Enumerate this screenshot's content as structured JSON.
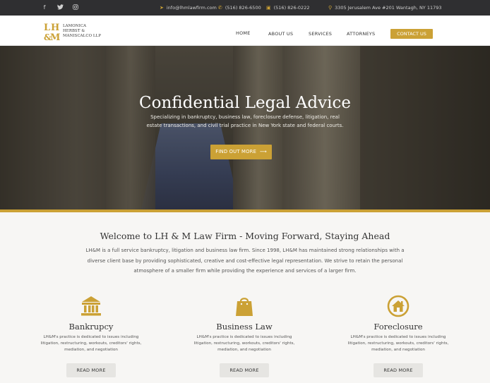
{
  "topbar": {
    "social": [
      "facebook-icon",
      "twitter-icon",
      "instagram-icon"
    ],
    "email": "info@lhmlawfirm.com",
    "phone": "(516) 826-6500",
    "fax": "(516) 826-0222",
    "address": "3305 Jerusalem Ave #201 Wantagh, NY 11793"
  },
  "logo": {
    "line1": "LAMONICA",
    "line2": "HERBST &",
    "line3": "MANISCALCO LLP"
  },
  "nav": {
    "items": [
      "HOME",
      "ABOUT US",
      "SERVICES",
      "ATTORNEYS"
    ],
    "cta": "CONTACT US"
  },
  "hero": {
    "title": "Confidential Legal Advice",
    "subtitle": "Specializing in bankruptcy, business law, foreclosure defense, litigation, real estate transactions, and civil trial practice in New York state and federal courts.",
    "button": "FIND OUT MORE"
  },
  "welcome": {
    "title": "Welcome to LH & M Law Firm - Moving Forward, Staying Ahead",
    "text": "LH&M is a full service bankruptcy, litigation and business law firm. Since 1998, LH&M has maintained strong relationships with a diverse client base by providing sophisticated, creative and cost-effective legal representation. We strive to retain the personal atmosphere of a smaller firm while providing the experience and services of a larger firm."
  },
  "areas": [
    {
      "icon": "bank-icon",
      "name": "Bankrupcy",
      "desc": "LH&M's practice is dedicated to issues including litigation, restructuring, workouts, creditors' rights, mediation, and negotiation",
      "button": "READ MORE"
    },
    {
      "icon": "briefcase-icon",
      "name": "Business Law",
      "desc": "LH&M's practice is dedicated to issues including litigation, restructuring, workouts, creditors' rights, mediation, and negotiation",
      "button": "READ MORE"
    },
    {
      "icon": "house-icon",
      "name": "Foreclosure",
      "desc": "LH&M's practice is dedicated to issues including litigation, restructuring, workouts, creditors' rights, mediation, and negotiation",
      "button": "READ MORE"
    }
  ],
  "colors": {
    "accent": "#cba135",
    "dark": "#2f2f31"
  }
}
